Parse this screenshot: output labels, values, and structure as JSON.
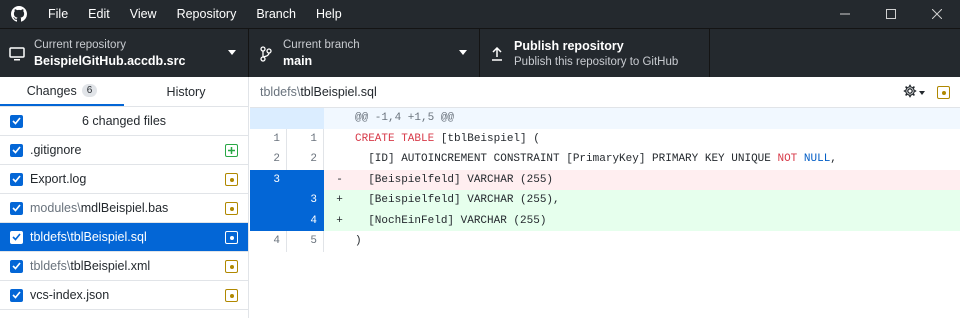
{
  "menu": [
    "File",
    "Edit",
    "View",
    "Repository",
    "Branch",
    "Help"
  ],
  "toolbar": {
    "repo": {
      "label": "Current repository",
      "value": "BeispielGitHub.accdb.src"
    },
    "branch": {
      "label": "Current branch",
      "value": "main"
    },
    "publish": {
      "title": "Publish repository",
      "subtitle": "Publish this repository to GitHub"
    }
  },
  "sidebar": {
    "tabs": {
      "changes": "Changes",
      "changes_count": "6",
      "history": "History"
    },
    "changed_files_label": "6 changed files",
    "files": [
      {
        "dir": "",
        "name": ".gitignore",
        "status": "added",
        "selected": false
      },
      {
        "dir": "",
        "name": "Export.log",
        "status": "modified",
        "selected": false
      },
      {
        "dir": "modules\\",
        "name": "mdlBeispiel.bas",
        "status": "modified",
        "selected": false
      },
      {
        "dir": "tbldefs\\",
        "name": "tblBeispiel.sql",
        "status": "modified",
        "selected": true
      },
      {
        "dir": "tbldefs\\",
        "name": "tblBeispiel.xml",
        "status": "modified",
        "selected": false
      },
      {
        "dir": "",
        "name": "vcs-index.json",
        "status": "modified",
        "selected": false
      }
    ]
  },
  "diff": {
    "path_dir": "tbldefs\\",
    "path_file": "tblBeispiel.sql",
    "hunk": "@@ -1,4 +1,5 @@",
    "lines": [
      {
        "type": "ctx",
        "old": "1",
        "new": "1",
        "marker": "",
        "text": "CREATE TABLE [tblBeispiel] ("
      },
      {
        "type": "ctx",
        "old": "2",
        "new": "2",
        "marker": "",
        "text": "  [ID] AUTOINCREMENT CONSTRAINT [PrimaryKey] PRIMARY KEY UNIQUE NOT NULL,"
      },
      {
        "type": "del",
        "old": "3",
        "new": "",
        "marker": "-",
        "text": "  [Beispielfeld] VARCHAR (255)"
      },
      {
        "type": "add",
        "old": "",
        "new": "3",
        "marker": "+",
        "text": "  [Beispielfeld] VARCHAR (255),"
      },
      {
        "type": "add",
        "old": "",
        "new": "4",
        "marker": "+",
        "text": "  [NochEinFeld] VARCHAR (255)"
      },
      {
        "type": "ctx",
        "old": "4",
        "new": "5",
        "marker": "",
        "text": ")"
      }
    ]
  },
  "colors": {
    "accent": "#0366d6",
    "modified": "#b08800",
    "added": "#28a745",
    "titlebar": "#24292e"
  }
}
